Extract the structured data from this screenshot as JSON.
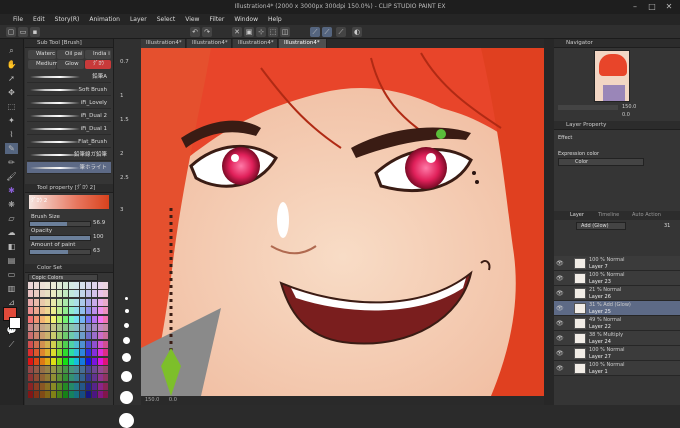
{
  "window": {
    "title": "Illustration4* (2000 x 3000px 300dpi 150.0%) - CLIP STUDIO PAINT EX"
  },
  "menu": [
    "File",
    "Edit",
    "Story(R)",
    "Animation",
    "Layer",
    "Select",
    "View",
    "Filter",
    "Window",
    "Help"
  ],
  "canvas_tabs": [
    "Illustration4*",
    "Illustration4*",
    "Illustration4*",
    "Illustration4*"
  ],
  "subtool": {
    "header": "Sub Tool [Brush]",
    "tabs": [
      "Waterc",
      "Oil pai",
      "India i",
      "Medium",
      "Glow",
      "ｸﾞﾛｳ"
    ],
    "brushes": [
      "鉛筆A",
      "Soft Brush",
      "iFi_Lovely",
      "iFi_Dual 2",
      "iFi_Dual 1",
      "Flat_Brush",
      "鉛筆線ガ鉛筆",
      "筆ホライト"
    ]
  },
  "tool_property": {
    "header": "Tool property [ｸﾞﾛｳ 2]",
    "preset": "ｸﾞﾛｳ 2",
    "brush_size_label": "Brush Size",
    "brush_size_value": "56.9",
    "brush_size_fraction": 0.62,
    "opacity_label": "Opacity",
    "opacity_value": "100",
    "opacity_fraction": 1.0,
    "paint_label": "Amount of paint",
    "paint_value": "63",
    "paint_fraction": 0.63
  },
  "color_set": {
    "header": "Color Set",
    "selected": "Copic Colors"
  },
  "brush_sizes": [
    "0.7",
    "1",
    "1.5",
    "2",
    "2.5",
    "3"
  ],
  "navigator": {
    "header": "Navigator",
    "zoom": "150.0",
    "rotate": "0.0"
  },
  "layer_property": {
    "header": "Layer Property",
    "effect_label": "Effect",
    "expression_label": "Expression color",
    "expression_value": "Color"
  },
  "layer_panel": {
    "tabs": [
      "Layer",
      "Timeline",
      "Auto Action"
    ],
    "blend": "Add (Glow)",
    "opacity": "31",
    "layers": [
      {
        "mode": "100 % Normal",
        "name": "Layer 7"
      },
      {
        "mode": "100 % Normal",
        "name": "Layer 23"
      },
      {
        "mode": "21 % Normal",
        "name": "Layer 26"
      },
      {
        "mode": "31 % Add (Glow)",
        "name": "Layer 25"
      },
      {
        "mode": "49 % Normal",
        "name": "Layer 22"
      },
      {
        "mode": "38 % Multiply",
        "name": "Layer 24"
      },
      {
        "mode": "100 % Normal",
        "name": "Layer 27"
      },
      {
        "mode": "100 % Normal",
        "name": "Layer 1"
      }
    ]
  },
  "status": {
    "zoom": "150.0",
    "angle": "0.0"
  },
  "colors": {
    "accent": "#5d6a86",
    "hair": "#e8452a",
    "eye": "#e02060",
    "earring": "#7dbf2a"
  }
}
